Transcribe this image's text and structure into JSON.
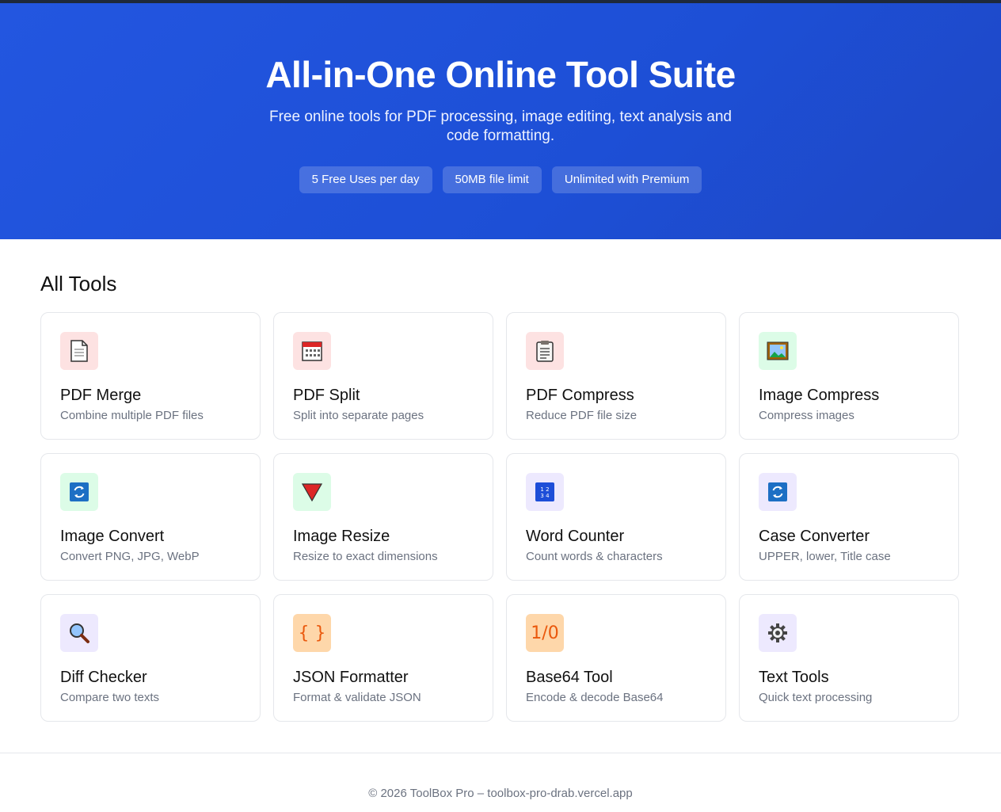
{
  "hero": {
    "title": "All-in-One Online Tool Suite",
    "subtitle": "Free online tools for PDF processing, image editing, text analysis and code formatting.",
    "badges": [
      "5 Free Uses per day",
      "50MB file limit",
      "Unlimited with Premium"
    ]
  },
  "section_title": "All Tools",
  "tools": [
    {
      "name": "PDF Merge",
      "desc": "Combine multiple PDF files",
      "icon": "page-icon"
    },
    {
      "name": "PDF Split",
      "desc": "Split into separate pages",
      "icon": "calendar-icon"
    },
    {
      "name": "PDF Compress",
      "desc": "Reduce PDF file size",
      "icon": "clipboard-icon"
    },
    {
      "name": "Image Compress",
      "desc": "Compress images",
      "icon": "picture-icon"
    },
    {
      "name": "Image Convert",
      "desc": "Convert PNG, JPG, WebP",
      "icon": "refresh-icon"
    },
    {
      "name": "Image Resize",
      "desc": "Resize to exact dimensions",
      "icon": "triangle-down-icon"
    },
    {
      "name": "Word Counter",
      "desc": "Count words & characters",
      "icon": "numbers-icon"
    },
    {
      "name": "Case Converter",
      "desc": "UPPER, lower, Title case",
      "icon": "refresh-icon"
    },
    {
      "name": "Diff Checker",
      "desc": "Compare two texts",
      "icon": "magnifier-icon"
    },
    {
      "name": "JSON Formatter",
      "desc": "Format & validate JSON",
      "icon": "braces-icon",
      "glyph": "{ }"
    },
    {
      "name": "Base64 Tool",
      "desc": "Encode & decode Base64",
      "icon": "binary-icon",
      "glyph": "1/0"
    },
    {
      "name": "Text Tools",
      "desc": "Quick text processing",
      "icon": "gear-icon"
    }
  ],
  "footer": "© 2026 ToolBox Pro – toolbox-pro-drab.vercel.app",
  "colors": {
    "hero": "#1d4fd6",
    "red_tile": "#fde2e2",
    "green_tile": "#dcfce7",
    "purple_tile": "#ede9fe",
    "orange_tile": "#fed7aa"
  }
}
